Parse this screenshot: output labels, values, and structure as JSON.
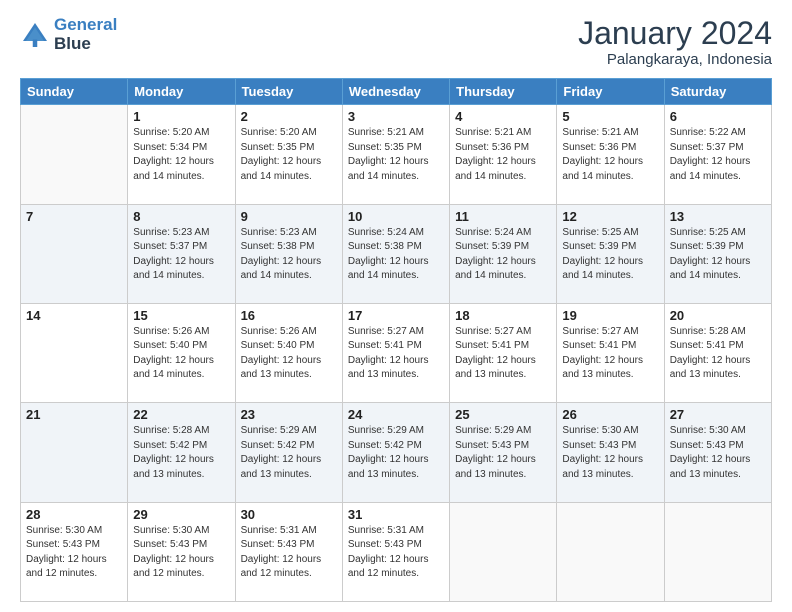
{
  "header": {
    "logo_line1": "General",
    "logo_line2": "Blue",
    "title": "January 2024",
    "subtitle": "Palangkaraya, Indonesia"
  },
  "calendar": {
    "headers": [
      "Sunday",
      "Monday",
      "Tuesday",
      "Wednesday",
      "Thursday",
      "Friday",
      "Saturday"
    ],
    "weeks": [
      [
        {
          "day": "",
          "info": ""
        },
        {
          "day": "1",
          "info": "Sunrise: 5:20 AM\nSunset: 5:34 PM\nDaylight: 12 hours\nand 14 minutes."
        },
        {
          "day": "2",
          "info": "Sunrise: 5:20 AM\nSunset: 5:35 PM\nDaylight: 12 hours\nand 14 minutes."
        },
        {
          "day": "3",
          "info": "Sunrise: 5:21 AM\nSunset: 5:35 PM\nDaylight: 12 hours\nand 14 minutes."
        },
        {
          "day": "4",
          "info": "Sunrise: 5:21 AM\nSunset: 5:36 PM\nDaylight: 12 hours\nand 14 minutes."
        },
        {
          "day": "5",
          "info": "Sunrise: 5:21 AM\nSunset: 5:36 PM\nDaylight: 12 hours\nand 14 minutes."
        },
        {
          "day": "6",
          "info": "Sunrise: 5:22 AM\nSunset: 5:37 PM\nDaylight: 12 hours\nand 14 minutes."
        }
      ],
      [
        {
          "day": "7",
          "info": ""
        },
        {
          "day": "8",
          "info": "Sunrise: 5:23 AM\nSunset: 5:37 PM\nDaylight: 12 hours\nand 14 minutes."
        },
        {
          "day": "9",
          "info": "Sunrise: 5:23 AM\nSunset: 5:38 PM\nDaylight: 12 hours\nand 14 minutes."
        },
        {
          "day": "10",
          "info": "Sunrise: 5:24 AM\nSunset: 5:38 PM\nDaylight: 12 hours\nand 14 minutes."
        },
        {
          "day": "11",
          "info": "Sunrise: 5:24 AM\nSunset: 5:39 PM\nDaylight: 12 hours\nand 14 minutes."
        },
        {
          "day": "12",
          "info": "Sunrise: 5:25 AM\nSunset: 5:39 PM\nDaylight: 12 hours\nand 14 minutes."
        },
        {
          "day": "13",
          "info": "Sunrise: 5:25 AM\nSunset: 5:39 PM\nDaylight: 12 hours\nand 14 minutes."
        }
      ],
      [
        {
          "day": "14",
          "info": ""
        },
        {
          "day": "15",
          "info": "Sunrise: 5:26 AM\nSunset: 5:40 PM\nDaylight: 12 hours\nand 14 minutes."
        },
        {
          "day": "16",
          "info": "Sunrise: 5:26 AM\nSunset: 5:40 PM\nDaylight: 12 hours\nand 13 minutes."
        },
        {
          "day": "17",
          "info": "Sunrise: 5:27 AM\nSunset: 5:41 PM\nDaylight: 12 hours\nand 13 minutes."
        },
        {
          "day": "18",
          "info": "Sunrise: 5:27 AM\nSunset: 5:41 PM\nDaylight: 12 hours\nand 13 minutes."
        },
        {
          "day": "19",
          "info": "Sunrise: 5:27 AM\nSunset: 5:41 PM\nDaylight: 12 hours\nand 13 minutes."
        },
        {
          "day": "20",
          "info": "Sunrise: 5:28 AM\nSunset: 5:41 PM\nDaylight: 12 hours\nand 13 minutes."
        }
      ],
      [
        {
          "day": "21",
          "info": ""
        },
        {
          "day": "22",
          "info": "Sunrise: 5:28 AM\nSunset: 5:42 PM\nDaylight: 12 hours\nand 13 minutes."
        },
        {
          "day": "23",
          "info": "Sunrise: 5:29 AM\nSunset: 5:42 PM\nDaylight: 12 hours\nand 13 minutes."
        },
        {
          "day": "24",
          "info": "Sunrise: 5:29 AM\nSunset: 5:42 PM\nDaylight: 12 hours\nand 13 minutes."
        },
        {
          "day": "25",
          "info": "Sunrise: 5:29 AM\nSunset: 5:43 PM\nDaylight: 12 hours\nand 13 minutes."
        },
        {
          "day": "26",
          "info": "Sunrise: 5:30 AM\nSunset: 5:43 PM\nDaylight: 12 hours\nand 13 minutes."
        },
        {
          "day": "27",
          "info": "Sunrise: 5:30 AM\nSunset: 5:43 PM\nDaylight: 12 hours\nand 13 minutes."
        }
      ],
      [
        {
          "day": "28",
          "info": "Sunrise: 5:30 AM\nSunset: 5:43 PM\nDaylight: 12 hours\nand 12 minutes."
        },
        {
          "day": "29",
          "info": "Sunrise: 5:30 AM\nSunset: 5:43 PM\nDaylight: 12 hours\nand 12 minutes."
        },
        {
          "day": "30",
          "info": "Sunrise: 5:31 AM\nSunset: 5:43 PM\nDaylight: 12 hours\nand 12 minutes."
        },
        {
          "day": "31",
          "info": "Sunrise: 5:31 AM\nSunset: 5:43 PM\nDaylight: 12 hours\nand 12 minutes."
        },
        {
          "day": "",
          "info": ""
        },
        {
          "day": "",
          "info": ""
        },
        {
          "day": "",
          "info": ""
        }
      ]
    ]
  }
}
